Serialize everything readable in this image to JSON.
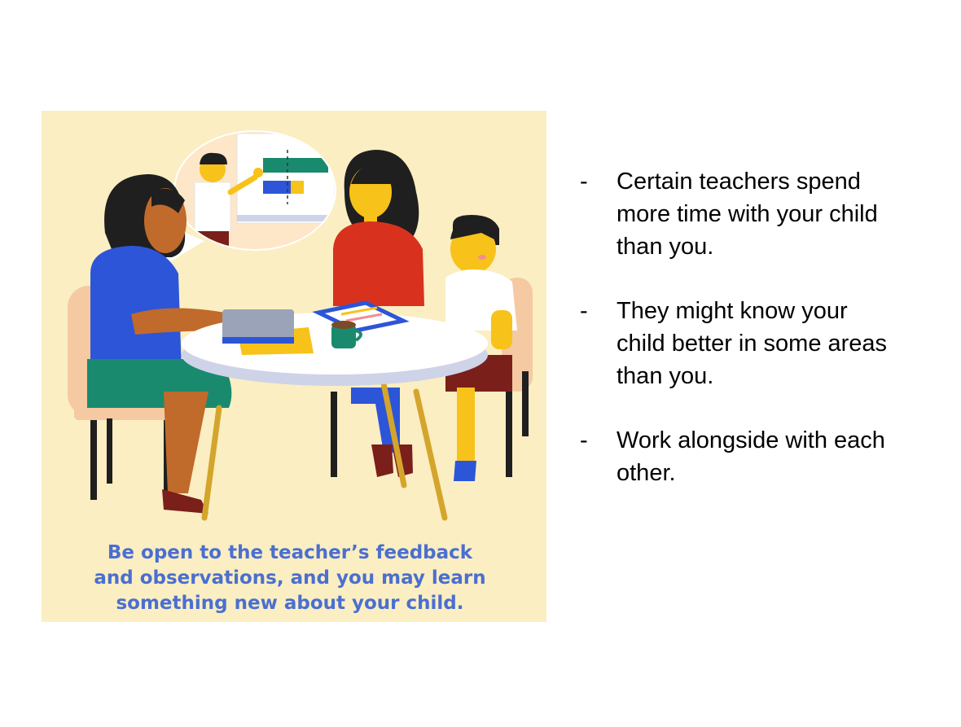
{
  "illustration": {
    "caption_lines": [
      "Be open to the teacher’s feedback",
      "and observations, and you may learn",
      "something new about your child."
    ],
    "colors": {
      "background": "#fbeec2",
      "caption": "#4a6fd0",
      "teacher_shirt": "#2c55d8",
      "teacher_skirt": "#1a8a6e",
      "mother_shirt": "#d8321f",
      "mother_pants": "#2c55d8",
      "child_shirt": "#ffffff",
      "child_shorts": "#7a1f1a",
      "skin_yellow": "#f7c21a",
      "table": "#ffffff"
    }
  },
  "bullets": [
    {
      "marker": "-",
      "lines": [
        "Certain teachers spend",
        "more time with your child",
        "than you."
      ]
    },
    {
      "marker": "-",
      "lines": [
        "They might know your",
        "child better in some areas",
        "than you."
      ]
    },
    {
      "marker": "-",
      "lines": [
        "Work alongside with each",
        "other."
      ]
    }
  ]
}
